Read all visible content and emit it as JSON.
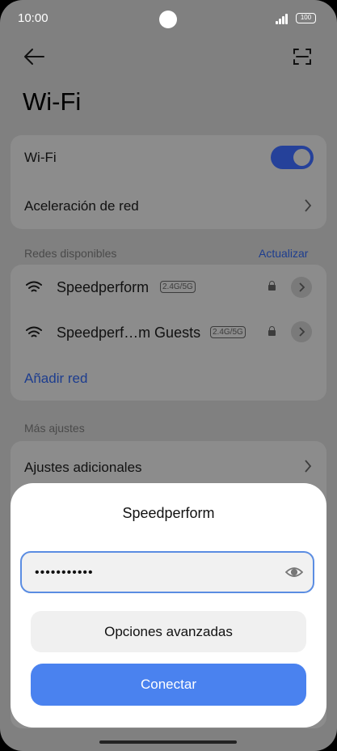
{
  "status_bar": {
    "time": "10:00",
    "battery": "100"
  },
  "header": {
    "title": "Wi-Fi"
  },
  "wifi_card": {
    "wifi_label": "Wi-Fi",
    "wifi_enabled": true,
    "accel_label": "Aceleración de red"
  },
  "networks": {
    "section_label": "Redes disponibles",
    "refresh_label": "Actualizar",
    "items": [
      {
        "name": "Speedperform",
        "band": "2.4G/5G",
        "secured": true
      },
      {
        "name": "Speedperf…m Guests",
        "band": "2.4G/5G",
        "secured": true
      }
    ],
    "add_label": "Añadir red"
  },
  "more": {
    "section_label": "Más ajustes",
    "additional_label": "Ajustes adicionales"
  },
  "dialog": {
    "title": "Speedperform",
    "password_value": "•••••••••••",
    "advanced_label": "Opciones avanzadas",
    "connect_label": "Conectar"
  },
  "colors": {
    "accent": "#4a82ef",
    "focus_border": "#5b8de2",
    "overlay": "#808080"
  },
  "icons": [
    "back-arrow-icon",
    "scan-icon",
    "wifi-icon",
    "lock-icon",
    "chevron-right-icon",
    "eye-icon"
  ]
}
